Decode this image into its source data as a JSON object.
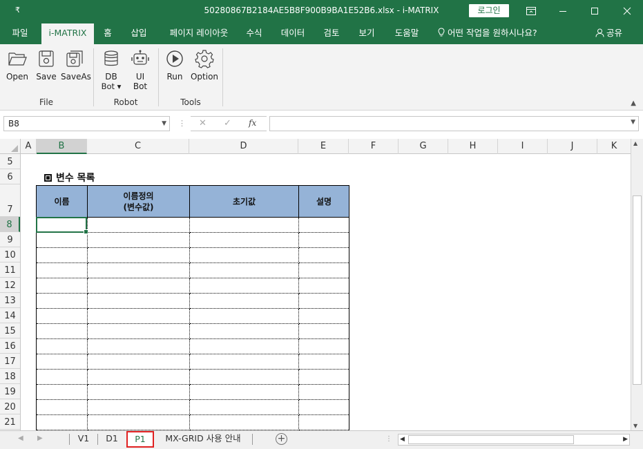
{
  "window": {
    "quick_access": "₹",
    "title": "50280867B2184AE5B8F900B9BA1E52B6.xlsx  -  i-MATRIX",
    "login_label": "로그인"
  },
  "tabs": [
    {
      "label": "파일"
    },
    {
      "label": "i-MATRIX",
      "active": true
    },
    {
      "label": "홈"
    },
    {
      "label": "삽입"
    },
    {
      "label": "페이지 레이아웃"
    },
    {
      "label": "수식"
    },
    {
      "label": "데이터"
    },
    {
      "label": "검토"
    },
    {
      "label": "보기"
    },
    {
      "label": "도움말"
    }
  ],
  "help_search": "어떤 작업을 원하시나요?",
  "share_label": "공유",
  "ribbon": {
    "groups": [
      {
        "label": "File",
        "buttons": [
          {
            "label": "Open"
          },
          {
            "label": "Save"
          },
          {
            "label": "SaveAs"
          }
        ]
      },
      {
        "label": "Robot",
        "buttons": [
          {
            "label": "DB",
            "label2": "Bot ▾"
          },
          {
            "label": "UI",
            "label2": "Bot"
          }
        ]
      },
      {
        "label": "Tools",
        "buttons": [
          {
            "label": "Run"
          },
          {
            "label": "Option"
          }
        ]
      }
    ]
  },
  "formula_bar": {
    "name_box": "B8",
    "formula": "",
    "fx_label": "fx"
  },
  "columns": [
    "A",
    "B",
    "C",
    "D",
    "E",
    "F",
    "G",
    "H",
    "I",
    "J",
    "K"
  ],
  "rows": [
    "5",
    "6",
    "7",
    "8",
    "9",
    "10",
    "11",
    "12",
    "13",
    "14",
    "15",
    "16",
    "17",
    "18",
    "19",
    "20",
    "21"
  ],
  "selected_cell": {
    "column": "B",
    "row": "8"
  },
  "section_title": "변수 목록",
  "table": {
    "headers": [
      "이름",
      "이름정의",
      "(변수값)",
      "초기값",
      "설명"
    ],
    "row_count": 14
  },
  "sheets": [
    {
      "label": "V1"
    },
    {
      "label": "D1"
    },
    {
      "label": "P1",
      "active": true
    },
    {
      "label": "MX-GRID 사용 안내"
    }
  ],
  "colors": {
    "brand": "#217346",
    "header_fill": "#95b3d7",
    "active_tab_outline": "#e02020"
  }
}
